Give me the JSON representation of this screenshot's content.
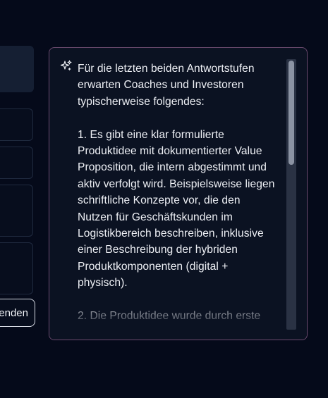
{
  "left": {
    "send_button_label": "enden"
  },
  "ai_panel": {
    "icon": "sparkle-icon",
    "text": "Für die letzten beiden Antwortstufen\nerwarten Coaches und Investoren\ntypischerweise folgendes:\n\n1. Es gibt eine klar formulierte\nProduktidee mit dokumentierter Value\nProposition, die intern abgestimmt und\naktiv verfolgt wird. Beispielsweise liegen\nschriftliche Konzepte vor, die den\nNutzen für Geschäftskunden im\nLogistikbereich beschreiben, inklusive\neiner Beschreibung der hybriden\nProduktkomponenten (digital +\nphysisch).\n\n2. Die Produktidee wurde durch erste"
  },
  "colors": {
    "background": "#050a1a",
    "panel_border": "#6b4a6e",
    "panel_background": "#0b1222",
    "text": "#eef0f5"
  }
}
